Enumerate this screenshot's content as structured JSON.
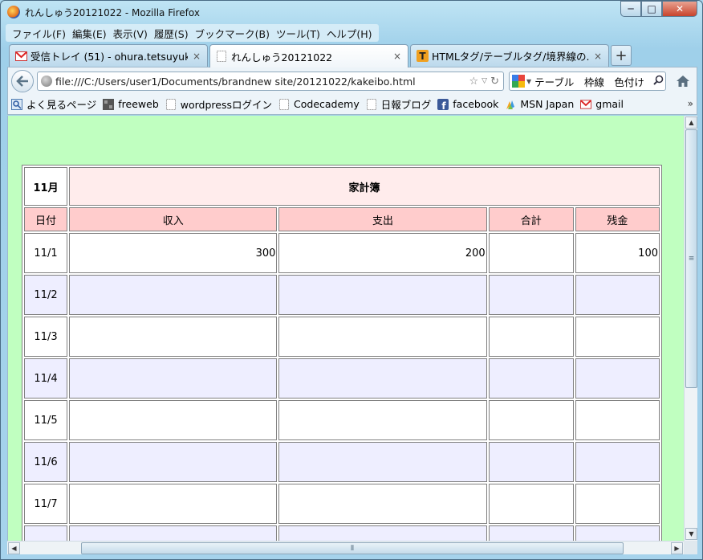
{
  "window": {
    "title": "れんしゅう20121022 - Mozilla Firefox",
    "minimize": "─",
    "maximize": "□",
    "close": "✕"
  },
  "menu": [
    {
      "label": "ファイル(F)"
    },
    {
      "label": "編集(E)"
    },
    {
      "label": "表示(V)"
    },
    {
      "label": "履歴(S)"
    },
    {
      "label": "ブックマーク(B)"
    },
    {
      "label": "ツール(T)"
    },
    {
      "label": "ヘルプ(H)"
    }
  ],
  "tabs": [
    {
      "label": "受信トレイ (51) - ohura.tetsuyuki...",
      "icon": "gmail-icon",
      "close": "×"
    },
    {
      "label": "れんしゅう20121022",
      "icon": "blank-page-icon",
      "close": "×"
    },
    {
      "label": "HTMLタグ/テーブルタグ/境界線の...",
      "icon": "t-icon",
      "close": "×"
    }
  ],
  "new_tab": "+",
  "nav": {
    "url": "file:///C:/Users/user1/Documents/brandnew site/20121022/kakeibo.html",
    "search_text": "テーブル　枠線　色付け"
  },
  "bookmarks": [
    {
      "label": "よく見るページ",
      "icon": "most-visited-icon"
    },
    {
      "label": "freeweb",
      "icon": "freeweb-icon"
    },
    {
      "label": "wordpressログイン",
      "icon": "blank-page-icon"
    },
    {
      "label": "Codecademy",
      "icon": "blank-page-icon"
    },
    {
      "label": "日報ブログ",
      "icon": "blank-page-icon"
    },
    {
      "label": "facebook",
      "icon": "facebook-icon"
    },
    {
      "label": "MSN Japan",
      "icon": "msn-icon"
    },
    {
      "label": "gmail",
      "icon": "gmail-icon"
    }
  ],
  "bookmarks_more": "»",
  "colors": {
    "page_bg": "#c0ffc0",
    "title_bg": "#ffecec",
    "header_bg": "#ffcccc",
    "stripe_bg": "#eeeeff"
  },
  "kakeibo": {
    "month": "11月",
    "title": "家計簿",
    "headers": [
      "日付",
      "収入",
      "支出",
      "合計",
      "残金"
    ],
    "rows": [
      {
        "date": "11/1",
        "income": "300",
        "expense": "200",
        "total": "",
        "balance": "100"
      },
      {
        "date": "11/2",
        "income": "",
        "expense": "",
        "total": "",
        "balance": ""
      },
      {
        "date": "11/3",
        "income": "",
        "expense": "",
        "total": "",
        "balance": ""
      },
      {
        "date": "11/4",
        "income": "",
        "expense": "",
        "total": "",
        "balance": ""
      },
      {
        "date": "11/5",
        "income": "",
        "expense": "",
        "total": "",
        "balance": ""
      },
      {
        "date": "11/6",
        "income": "",
        "expense": "",
        "total": "",
        "balance": ""
      },
      {
        "date": "11/7",
        "income": "",
        "expense": "",
        "total": "",
        "balance": ""
      },
      {
        "date": "",
        "income": "",
        "expense": "",
        "total": "",
        "balance": ""
      }
    ]
  }
}
